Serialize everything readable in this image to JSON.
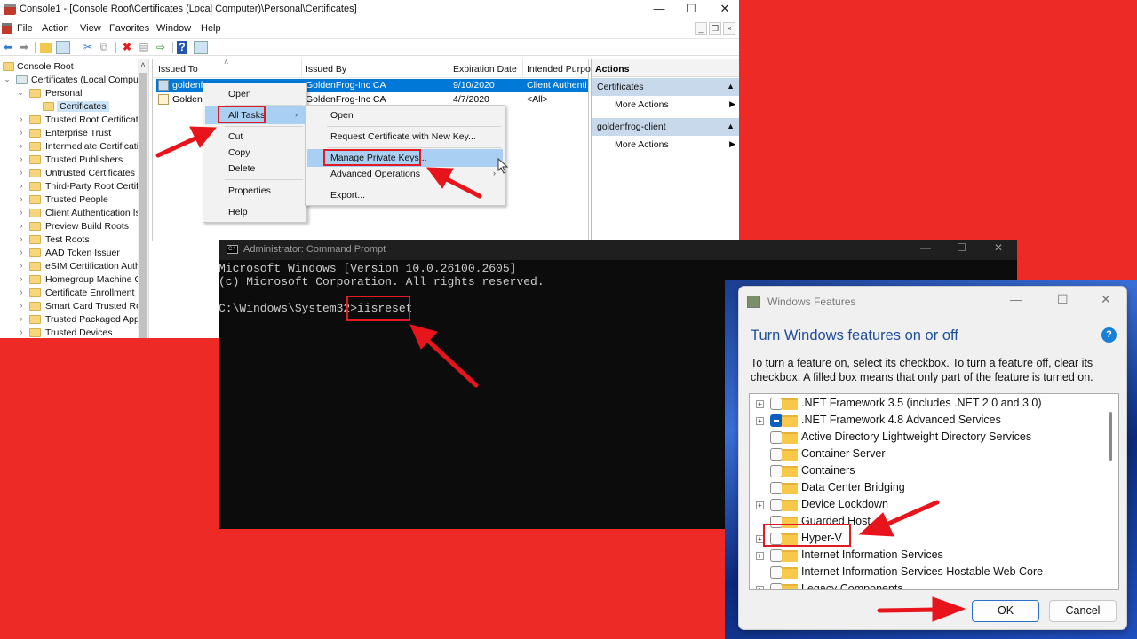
{
  "mmc": {
    "title": "Console1 - [Console Root\\Certificates (Local Computer)\\Personal\\Certificates]",
    "window_controls": {
      "minimize": "—",
      "maximize": "☐",
      "close": "✕"
    },
    "menu": [
      "File",
      "Action",
      "View",
      "Favorites",
      "Window",
      "Help"
    ],
    "mdi_controls": [
      "_",
      "❐",
      "×"
    ],
    "toolbar_icons": [
      "back-arrow-icon",
      "forward-arrow-icon",
      "up-folder-icon",
      "show-hide-tree-icon",
      "cut-icon",
      "copy-icon",
      "delete-icon",
      "properties-icon",
      "export-list-icon",
      "help-icon",
      "show-hide-action-pane-icon"
    ],
    "tree": {
      "root": "Console Root",
      "certificates_node": "Certificates (Local Comput",
      "personal": "Personal",
      "selected": "Certificates",
      "stores": [
        "Trusted Root Certificatio",
        "Enterprise Trust",
        "Intermediate Certificatio",
        "Trusted Publishers",
        "Untrusted Certificates",
        "Third-Party Root Certifi",
        "Trusted People",
        "Client Authentication Is",
        "Preview Build Roots",
        "Test Roots",
        "AAD Token Issuer",
        "eSIM Certification Auth",
        "Homegroup Machine C",
        "Certificate Enrollment R",
        "Smart Card Trusted Roo",
        "Trusted Packaged App I",
        "Trusted Devices"
      ]
    },
    "list": {
      "columns": [
        "Issued To",
        "Issued By",
        "Expiration Date",
        "Intended Purpo"
      ],
      "rows": [
        {
          "issued_to": "goldenfrog-client",
          "issued_to_visible": "goldenfr",
          "issued_by": "GoldenFrog-Inc CA",
          "expiration": "9/10/2020",
          "purpose": "Client Authenti",
          "selected": true
        },
        {
          "issued_to_visible": "GoldenF",
          "issued_by": "GoldenFrog-Inc CA",
          "expiration": "4/7/2020",
          "purpose": "<All>",
          "selected": false
        }
      ]
    },
    "actions": {
      "header": "Actions",
      "groups": [
        {
          "title": "Certificates",
          "item": "More Actions"
        },
        {
          "title": "goldenfrog-client",
          "item": "More Actions"
        }
      ]
    },
    "context_menu": {
      "items": [
        "Open",
        "All Tasks",
        "Cut",
        "Copy",
        "Delete",
        "Properties",
        "Help"
      ],
      "highlighted": "All Tasks"
    },
    "submenu": {
      "items": [
        "Open",
        "Request Certificate with New Key...",
        "Manage Private Keys...",
        "Advanced Operations",
        "Export..."
      ],
      "highlighted": "Manage Private Keys..."
    }
  },
  "cmd": {
    "title": "Administrator: Command Prompt",
    "icon_text": "C:\\",
    "controls": {
      "minimize": "—",
      "maximize": "☐",
      "close": "✕"
    },
    "lines": [
      "Microsoft Windows [Version 10.0.26100.2605]",
      "(c) Microsoft Corporation. All rights reserved.",
      "",
      "C:\\Windows\\System32>iisreset"
    ],
    "prompt": "C:\\Windows\\System32>",
    "command": "iisreset"
  },
  "features": {
    "title": "Windows Features",
    "controls": {
      "minimize": "—",
      "maximize": "☐",
      "close": "✕"
    },
    "heading": "Turn Windows features on or off",
    "help_label": "?",
    "description": "To turn a feature on, select its checkbox. To turn a feature off, clear its checkbox. A filled box means that only part of the feature is turned on.",
    "items": [
      {
        "label": ".NET Framework 3.5 (includes .NET 2.0 and 3.0)",
        "expandable": true,
        "state": "unchecked"
      },
      {
        "label": ".NET Framework 4.8 Advanced Services",
        "expandable": true,
        "state": "partial"
      },
      {
        "label": "Active Directory Lightweight Directory Services",
        "expandable": false,
        "state": "unchecked"
      },
      {
        "label": "Container Server",
        "expandable": false,
        "state": "unchecked"
      },
      {
        "label": "Containers",
        "expandable": false,
        "state": "unchecked"
      },
      {
        "label": "Data Center Bridging",
        "expandable": false,
        "state": "unchecked"
      },
      {
        "label": "Device Lockdown",
        "expandable": true,
        "state": "unchecked"
      },
      {
        "label": "Guarded Host",
        "expandable": false,
        "state": "unchecked"
      },
      {
        "label": "Hyper-V",
        "expandable": true,
        "state": "unchecked"
      },
      {
        "label": "Internet Information Services",
        "expandable": true,
        "state": "unchecked"
      },
      {
        "label": "Internet Information Services Hostable Web Core",
        "expandable": false,
        "state": "unchecked"
      },
      {
        "label": "Legacy Components",
        "expandable": true,
        "state": "unchecked"
      }
    ],
    "ok_label": "OK",
    "cancel_label": "Cancel"
  },
  "colors": {
    "background": "#ee2a26",
    "selection_blue": "#0078d7",
    "annotation_red": "#e01b22",
    "heading_blue": "#1f4e9b"
  }
}
